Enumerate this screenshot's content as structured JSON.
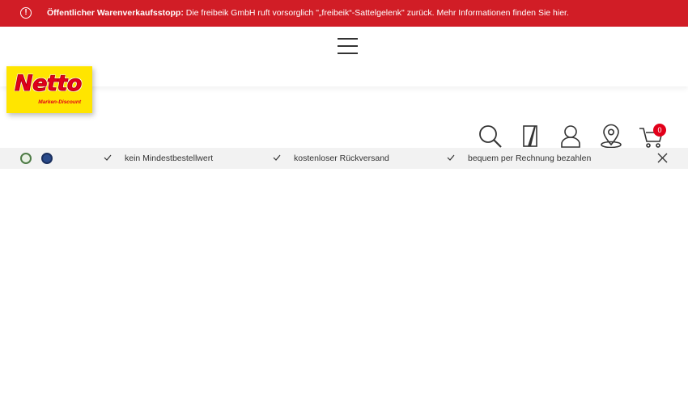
{
  "alert": {
    "icon": "exclamation-circle-icon",
    "title": "Öffentlicher Warenverkaufsstopp:",
    "message": " Die freibeik GmbH ruft vorsorglich \"„freibeik“-Sattelgelenk\" zurück. Mehr Informationen finden Sie hier.",
    "background": "#d11d26"
  },
  "header": {
    "menu_icon": "hamburger-menu-icon",
    "logo": {
      "word": "Netto",
      "sub": "Marken-Discount",
      "bg": "#ffe500",
      "color": "#e2001a"
    },
    "icons": [
      "search-icon",
      "wishlist-icon",
      "account-icon",
      "store-locator-icon",
      "cart-icon"
    ],
    "cart_count": "0"
  },
  "usp": {
    "items": [
      "kein Mindestbestellwert",
      "kostenloser Rückversand",
      "bequem per Rechnung bezahlen"
    ],
    "close_icon": "close-icon"
  }
}
